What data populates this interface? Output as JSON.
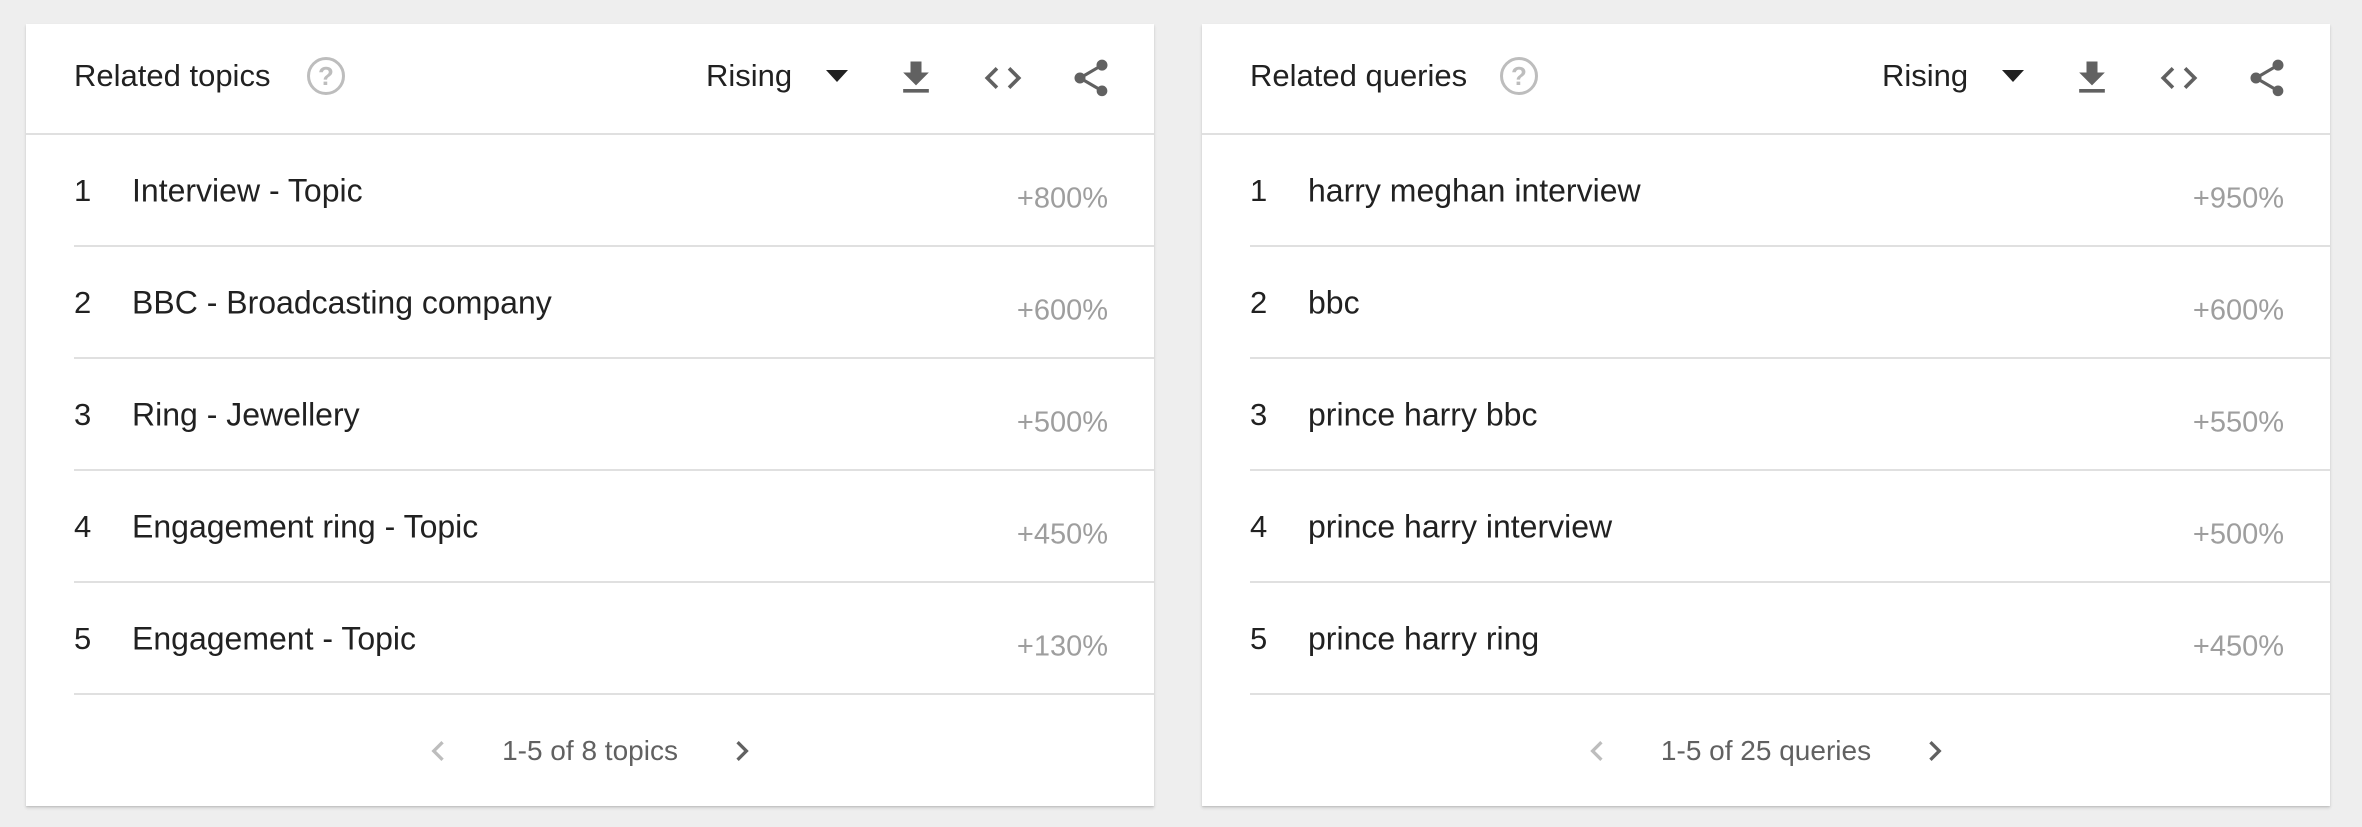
{
  "cards": [
    {
      "title": "Related topics",
      "mode": "Rising",
      "rows": [
        {
          "index": "1",
          "label": "Interview - Topic",
          "value": "+800%"
        },
        {
          "index": "2",
          "label": "BBC - Broadcasting company",
          "value": "+600%"
        },
        {
          "index": "3",
          "label": "Ring - Jewellery",
          "value": "+500%"
        },
        {
          "index": "4",
          "label": "Engagement ring - Topic",
          "value": "+450%"
        },
        {
          "index": "5",
          "label": "Engagement - Topic",
          "value": "+130%"
        }
      ],
      "pager": "1-5 of 8 topics"
    },
    {
      "title": "Related queries",
      "mode": "Rising",
      "rows": [
        {
          "index": "1",
          "label": "harry meghan interview",
          "value": "+950%"
        },
        {
          "index": "2",
          "label": "bbc",
          "value": "+600%"
        },
        {
          "index": "3",
          "label": "prince harry bbc",
          "value": "+550%"
        },
        {
          "index": "4",
          "label": "prince harry interview",
          "value": "+500%"
        },
        {
          "index": "5",
          "label": "prince harry ring",
          "value": "+450%"
        }
      ],
      "pager": "1-5 of 25 queries"
    }
  ],
  "icons": {
    "help": "help-circle-icon",
    "dropdown": "caret-down-icon",
    "download": "download-icon",
    "embed": "code-icon",
    "share": "share-icon",
    "prev": "chevron-left-icon",
    "next": "chevron-right-icon"
  },
  "colors": {
    "text": "#212121",
    "muted": "#9e9e9e",
    "icon": "#616161",
    "divider": "#e0e0e0",
    "background": "#eeeeee"
  }
}
